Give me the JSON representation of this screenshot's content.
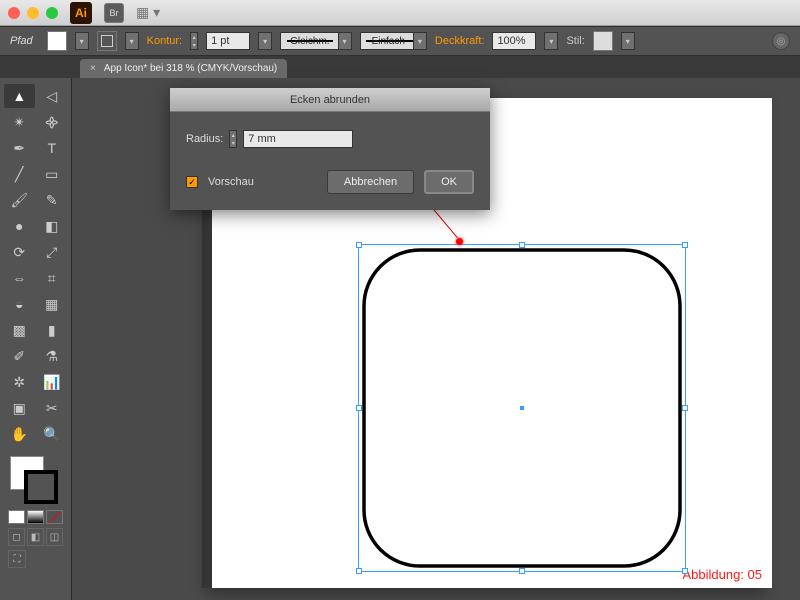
{
  "window": {
    "app_short": "Ai",
    "bridge_short": "Br"
  },
  "controlbar": {
    "mode_label": "Pfad",
    "stroke_label": "Kontur:",
    "stroke_weight": "1 pt",
    "profile_label": "Gleichm.",
    "brush_label": "Einfach",
    "opacity_label": "Deckkraft:",
    "opacity_value": "100%",
    "style_label": "Stil:"
  },
  "tab": {
    "title": "App Icon* bei 318 % (CMYK/Vorschau)"
  },
  "dialog": {
    "title": "Ecken abrunden",
    "radius_label": "Radius:",
    "radius_value": "7 mm",
    "preview_label": "Vorschau",
    "cancel": "Abbrechen",
    "ok": "OK"
  },
  "canvas": {
    "caption": "Abbildung: 05"
  },
  "tools": [
    "selection",
    "direct-selection",
    "magic-wand",
    "lasso",
    "pen",
    "type",
    "line",
    "rectangle",
    "brush",
    "pencil",
    "blob",
    "eraser",
    "rotate",
    "scale",
    "width",
    "free-transform",
    "shape-builder",
    "perspective",
    "mesh",
    "gradient",
    "eyedropper",
    "blend",
    "symbol-sprayer",
    "graph",
    "artboard",
    "slice",
    "hand",
    "zoom"
  ],
  "icons": {
    "tools": [
      "▲",
      "◁",
      "✴",
      "᯽",
      "✒",
      "T",
      "╱",
      "▭",
      "🖌",
      "✎",
      "●",
      "◧",
      "⟳",
      "⤢",
      "⇔",
      "⌗",
      "◒",
      "▦",
      "▩",
      "▮",
      "✐",
      "⚗",
      "✲",
      "📊",
      "▣",
      "✂",
      "✋",
      "🔍"
    ]
  }
}
